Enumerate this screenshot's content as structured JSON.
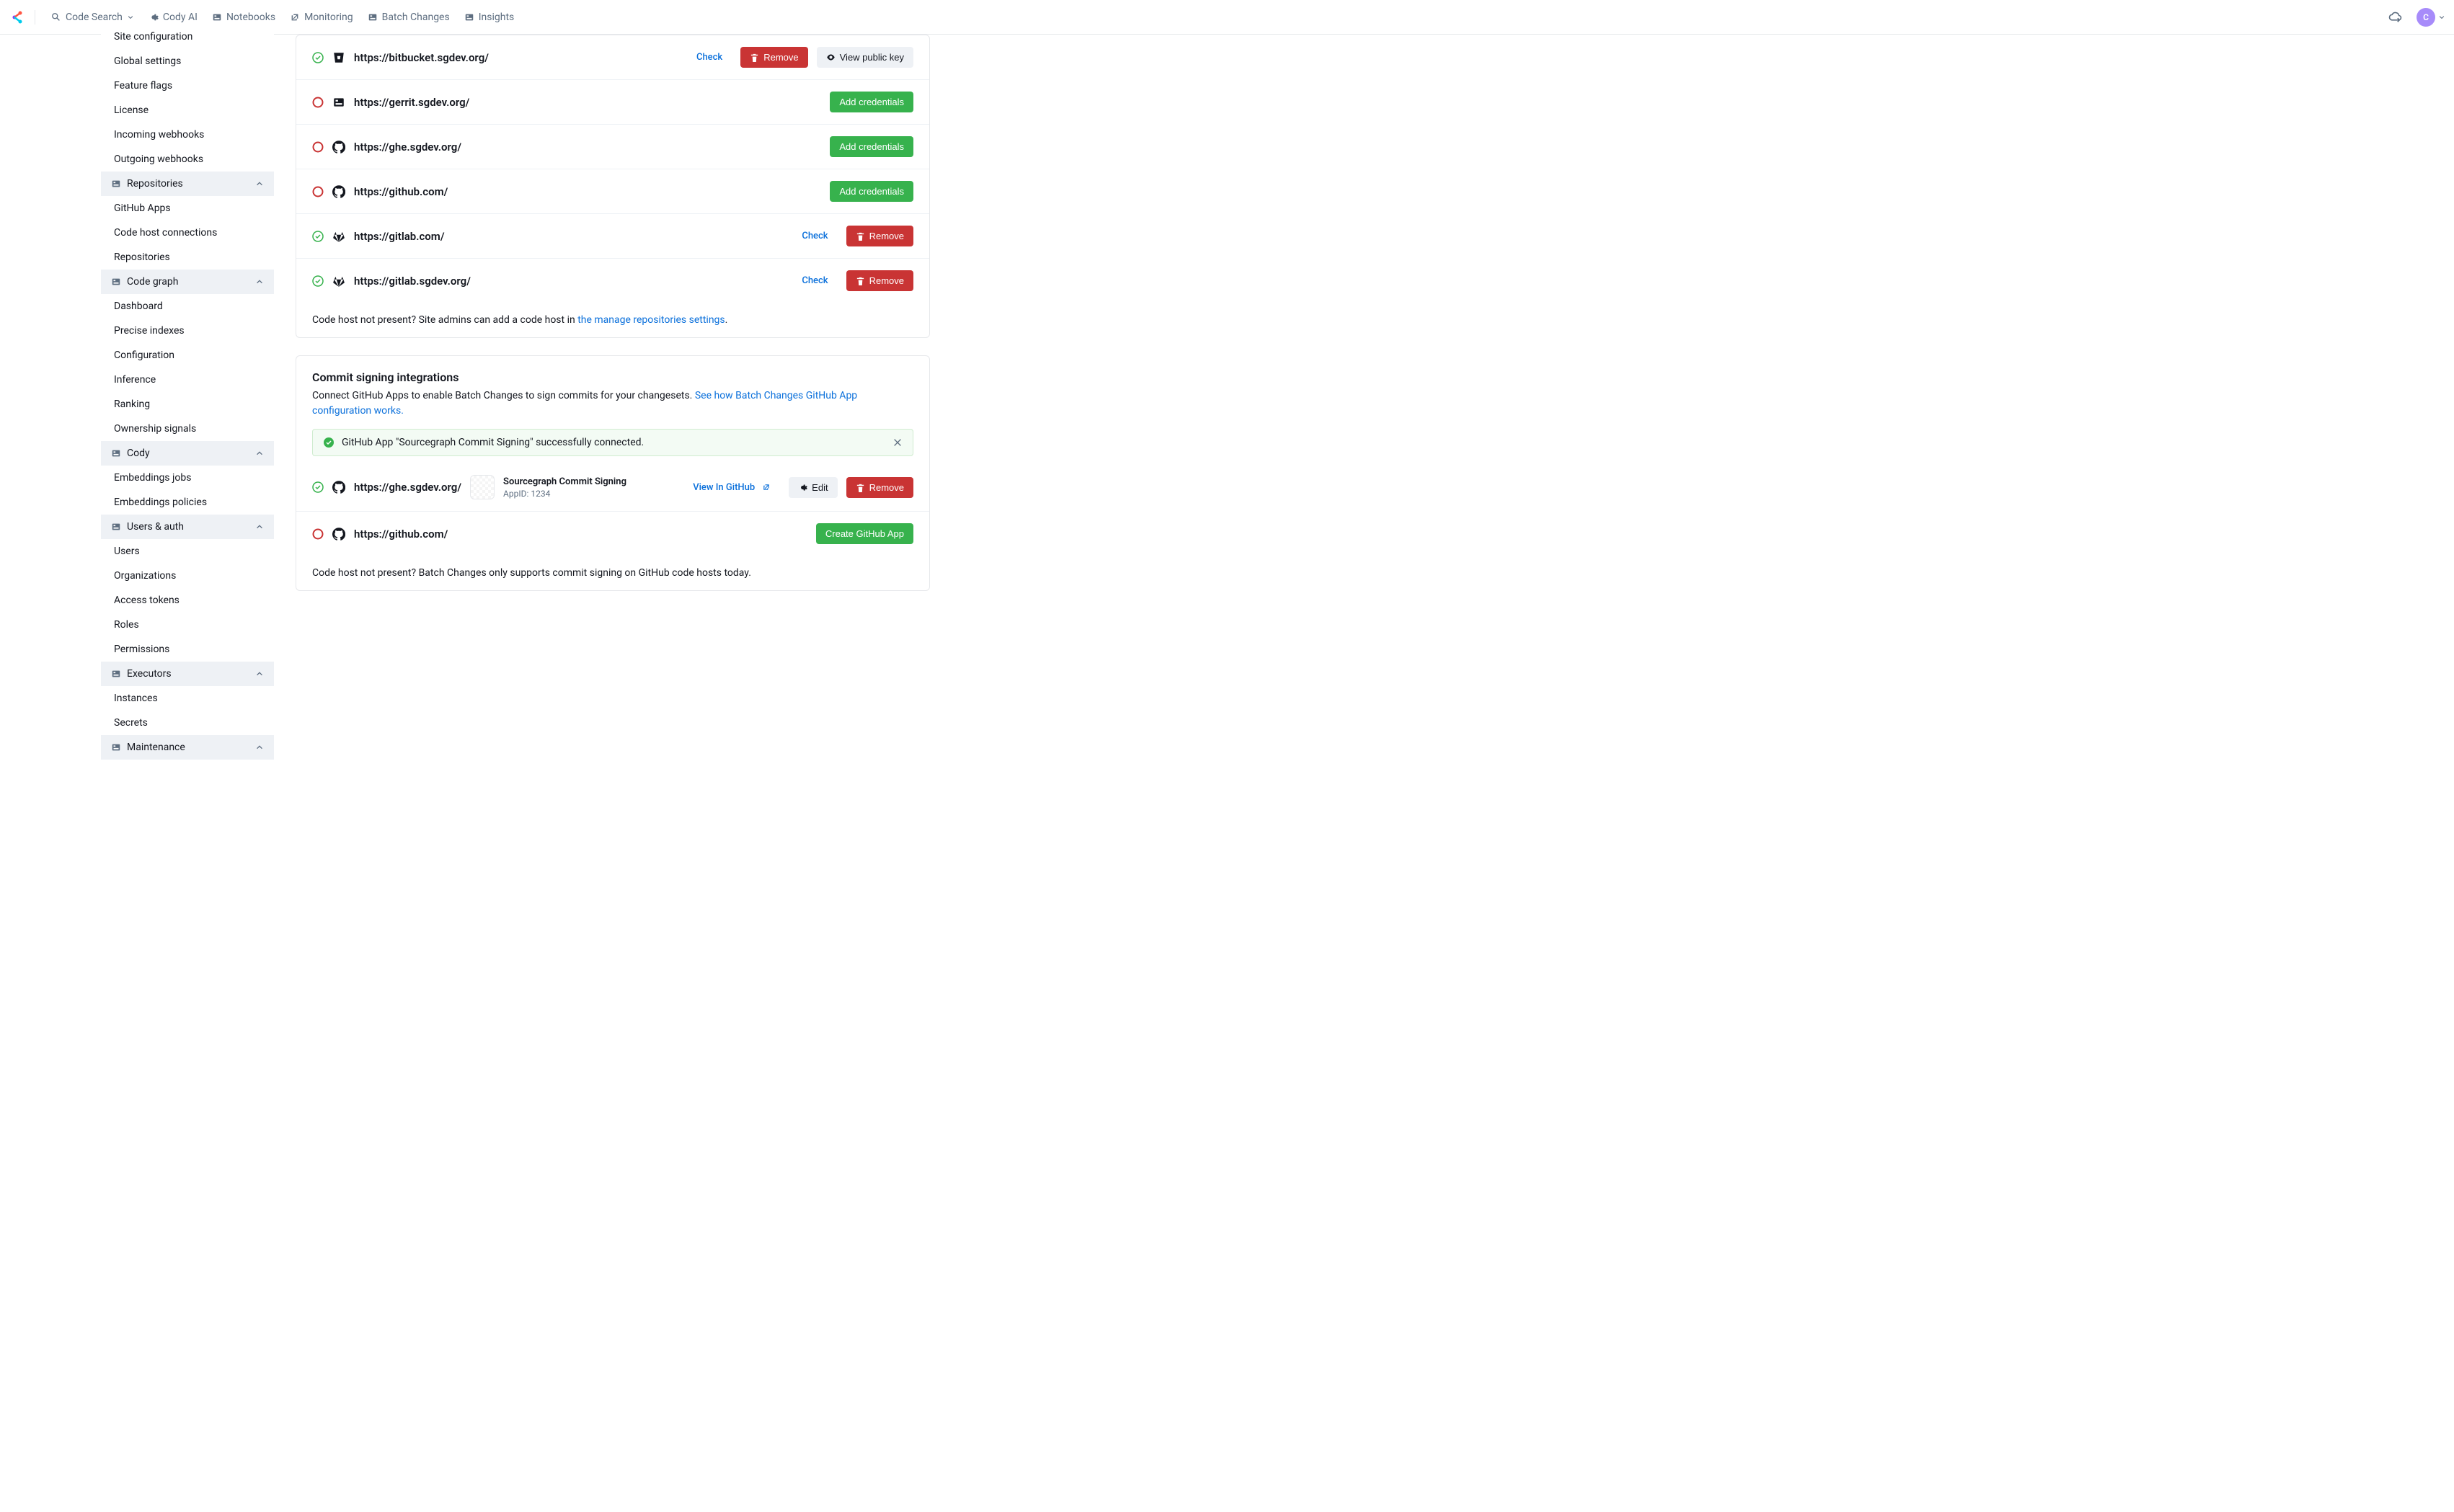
{
  "topnav": {
    "items": [
      {
        "label": "Code Search",
        "icon": "search",
        "hasDropdown": true
      },
      {
        "label": "Cody AI",
        "icon": "sparkle"
      },
      {
        "label": "Notebooks",
        "icon": "notebook"
      },
      {
        "label": "Monitoring",
        "icon": "pulse"
      },
      {
        "label": "Batch Changes",
        "icon": "batch"
      },
      {
        "label": "Insights",
        "icon": "chart"
      }
    ],
    "avatarLetter": "C"
  },
  "sidebar": {
    "topItems": [
      "Site configuration",
      "Global settings",
      "Feature flags",
      "License",
      "Incoming webhooks",
      "Outgoing webhooks"
    ],
    "groups": [
      {
        "title": "Repositories",
        "icon": "repo",
        "items": [
          "GitHub Apps",
          "Code host connections",
          "Repositories"
        ]
      },
      {
        "title": "Code graph",
        "icon": "graph",
        "items": [
          "Dashboard",
          "Precise indexes",
          "Configuration",
          "Inference",
          "Ranking",
          "Ownership signals"
        ]
      },
      {
        "title": "Cody",
        "icon": "cody",
        "items": [
          "Embeddings jobs",
          "Embeddings policies"
        ]
      },
      {
        "title": "Users & auth",
        "icon": "users",
        "items": [
          "Users",
          "Organizations",
          "Access tokens",
          "Roles",
          "Permissions"
        ]
      },
      {
        "title": "Executors",
        "icon": "cube",
        "items": [
          "Instances",
          "Secrets"
        ]
      },
      {
        "title": "Maintenance",
        "icon": "wrench",
        "items": []
      }
    ]
  },
  "hosts": {
    "rows": [
      {
        "status": "ok",
        "host": "bitbucket",
        "url": "https://bitbucket.sgdev.org/",
        "actions": [
          "check",
          "remove",
          "viewkey"
        ]
      },
      {
        "status": "bad",
        "host": "gerrit",
        "url": "https://gerrit.sgdev.org/",
        "actions": [
          "addcred"
        ]
      },
      {
        "status": "bad",
        "host": "github",
        "url": "https://ghe.sgdev.org/",
        "actions": [
          "addcred"
        ]
      },
      {
        "status": "bad",
        "host": "github",
        "url": "https://github.com/",
        "actions": [
          "addcred"
        ]
      },
      {
        "status": "ok",
        "host": "gitlab",
        "url": "https://gitlab.com/",
        "actions": [
          "check",
          "remove"
        ]
      },
      {
        "status": "ok",
        "host": "gitlab",
        "url": "https://gitlab.sgdev.org/",
        "actions": [
          "check",
          "remove"
        ]
      }
    ],
    "notePrefix": "Code host not present? Site admins can add a code host in ",
    "noteLink": "the manage repositories settings",
    "noteSuffix": "."
  },
  "labels": {
    "check": "Check",
    "remove": "Remove",
    "viewKey": "View public key",
    "addCred": "Add credentials",
    "viewInGithub": "View In GitHub",
    "edit": "Edit",
    "createApp": "Create GitHub App"
  },
  "commitSigning": {
    "title": "Commit signing integrations",
    "descPrefix": "Connect GitHub Apps to enable Batch Changes to sign commits for your changesets. ",
    "descLink": "See how Batch Changes GitHub App configuration works.",
    "alert": "GitHub App \"Sourcegraph Commit Signing\" successfully connected.",
    "rows": [
      {
        "status": "ok",
        "host": "github",
        "url": "https://ghe.sgdev.org/",
        "app": {
          "name": "Sourcegraph Commit Signing",
          "id": "AppID: 1234"
        },
        "actions": [
          "viewgh",
          "edit",
          "remove"
        ]
      },
      {
        "status": "bad",
        "host": "github",
        "url": "https://github.com/",
        "actions": [
          "createapp"
        ]
      }
    ],
    "note": "Code host not present? Batch Changes only supports commit signing on GitHub code hosts today."
  }
}
